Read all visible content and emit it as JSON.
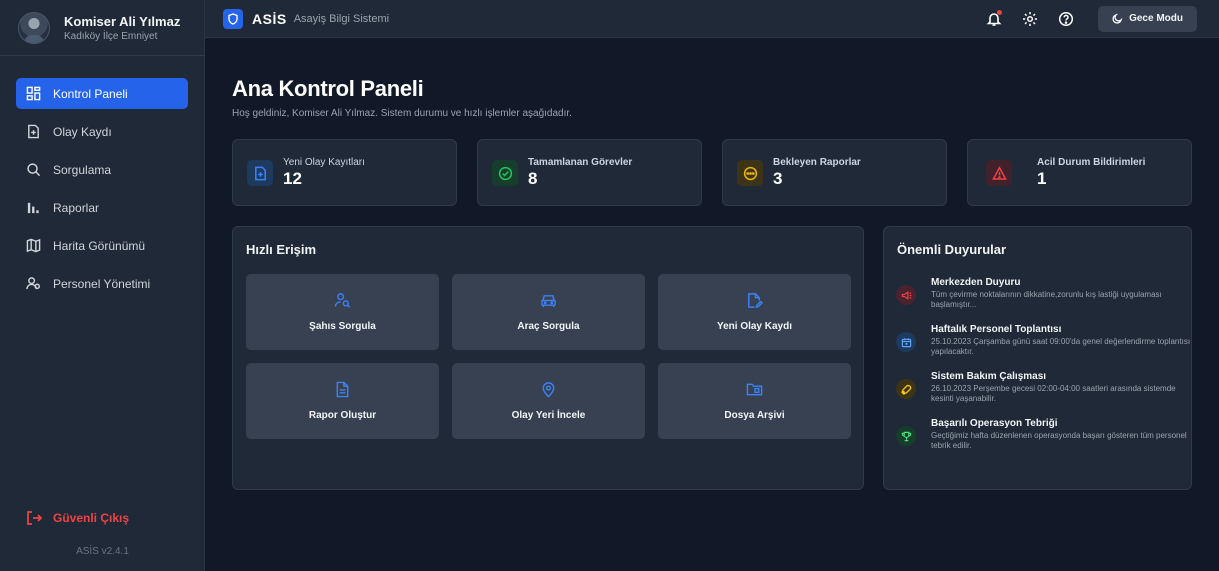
{
  "profile": {
    "name": "Komiser Ali Yılmaz",
    "unit": "Kadıköy İlçe Emniyet"
  },
  "sidebar": {
    "items": [
      {
        "label": "Kontrol Paneli",
        "icon": "dashboard-icon",
        "active": true
      },
      {
        "label": "Olay Kaydı",
        "icon": "file-plus-icon"
      },
      {
        "label": "Sorgulama",
        "icon": "search-icon"
      },
      {
        "label": "Raporlar",
        "icon": "bar-chart-icon"
      },
      {
        "label": "Harita Görünümü",
        "icon": "map-icon"
      },
      {
        "label": "Personel Yönetimi",
        "icon": "users-icon"
      }
    ],
    "logout": "Güvenli Çıkış",
    "version": "ASİS v2.4.1"
  },
  "header": {
    "brand": "ASİS",
    "subtitle": "Asayiş Bilgi Sistemi",
    "night_mode": "Gece Modu"
  },
  "main": {
    "title": "Ana Kontrol Paneli",
    "subtitle": "Hoş geldiniz, Komiser Ali Yılmaz. Sistem durumu ve hızlı işlemler aşağıdadır."
  },
  "stats": [
    {
      "label": "Yeni Olay Kayıtları",
      "value": "12",
      "color": "#3b82f6",
      "bg": "#1e3a5f"
    },
    {
      "label": "Tamamlanan Görevler",
      "value": "8",
      "color": "#22c55e",
      "bg": "#173d2c"
    },
    {
      "label": "Bekleyen Raporlar",
      "value": "3",
      "color": "#eab308",
      "bg": "#3d3417"
    },
    {
      "label": "Acil Durum Bildirimleri",
      "value": "1",
      "color": "#ef4444",
      "bg": "#42212a"
    }
  ],
  "quick_access": {
    "title": "Hızlı Erişim",
    "items": [
      {
        "label": "Şahıs Sorgula",
        "icon": "user-search-icon"
      },
      {
        "label": "Araç Sorgula",
        "icon": "car-icon"
      },
      {
        "label": "Yeni Olay Kaydı",
        "icon": "file-edit-icon"
      },
      {
        "label": "Rapor Oluştur",
        "icon": "file-text-icon"
      },
      {
        "label": "Olay Yeri İncele",
        "icon": "map-pin-icon"
      },
      {
        "label": "Dosya Arşivi",
        "icon": "archive-folder-icon"
      }
    ]
  },
  "announcements": {
    "title": "Önemli Duyurular",
    "items": [
      {
        "title": "Merkezden Duyuru",
        "text": "Tüm çevirme noktalarının dikkatine,zorunlu kış lastiği uygulaması başlamıştır...",
        "icon": "megaphone-icon",
        "color": "#ef4444",
        "bg": "#4a2230"
      },
      {
        "title": "Haftalık Personel Toplantısı",
        "text": "25.10.2023 Çarşamba günü saat 09:00'da genel değerlendirme toplantısı yapılacaktır.",
        "icon": "calendar-icon",
        "color": "#60a5fa",
        "bg": "#1e3a5f"
      },
      {
        "title": "Sistem Bakım Çalışması",
        "text": "26.10.2023 Perşembe gecesi 02:00-04:00 saatleri arasında sistemde kesinti yaşanabilir.",
        "icon": "wrench-icon",
        "color": "#facc15",
        "bg": "#3d3417"
      },
      {
        "title": "Başarılı Operasyon Tebriği",
        "text": "Geçtiğimiz hafta düzenlenen operasyonda başarı gösteren tüm personel tebrik edilir.",
        "icon": "trophy-icon",
        "color": "#4ade80",
        "bg": "#173d2c"
      }
    ]
  }
}
